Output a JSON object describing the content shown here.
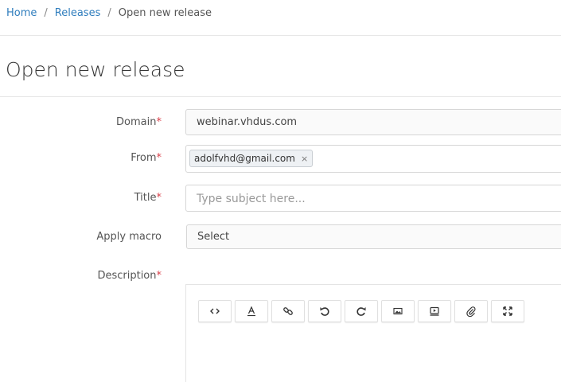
{
  "breadcrumb": {
    "home": "Home",
    "releases": "Releases",
    "current": "Open new release",
    "separator": "/"
  },
  "page": {
    "title": "Open new release"
  },
  "form": {
    "required_marker": "*",
    "domain": {
      "label": "Domain",
      "value": "webinar.vhdus.com"
    },
    "from": {
      "label": "From",
      "tag": "adolfvhd@gmail.com",
      "remove": "×"
    },
    "title": {
      "label": "Title",
      "placeholder": "Type subject here..."
    },
    "macro": {
      "label": "Apply macro",
      "value": "Select"
    },
    "description": {
      "label": "Description"
    }
  },
  "toolbar": {
    "buttons": [
      "code-icon",
      "font-color-icon",
      "link-icon",
      "undo-icon",
      "redo-icon",
      "image-icon",
      "video-icon",
      "attachment-icon",
      "fullscreen-icon"
    ]
  },
  "colors": {
    "link": "#2f7dbd",
    "required": "#d9404a",
    "text": "#333333"
  }
}
